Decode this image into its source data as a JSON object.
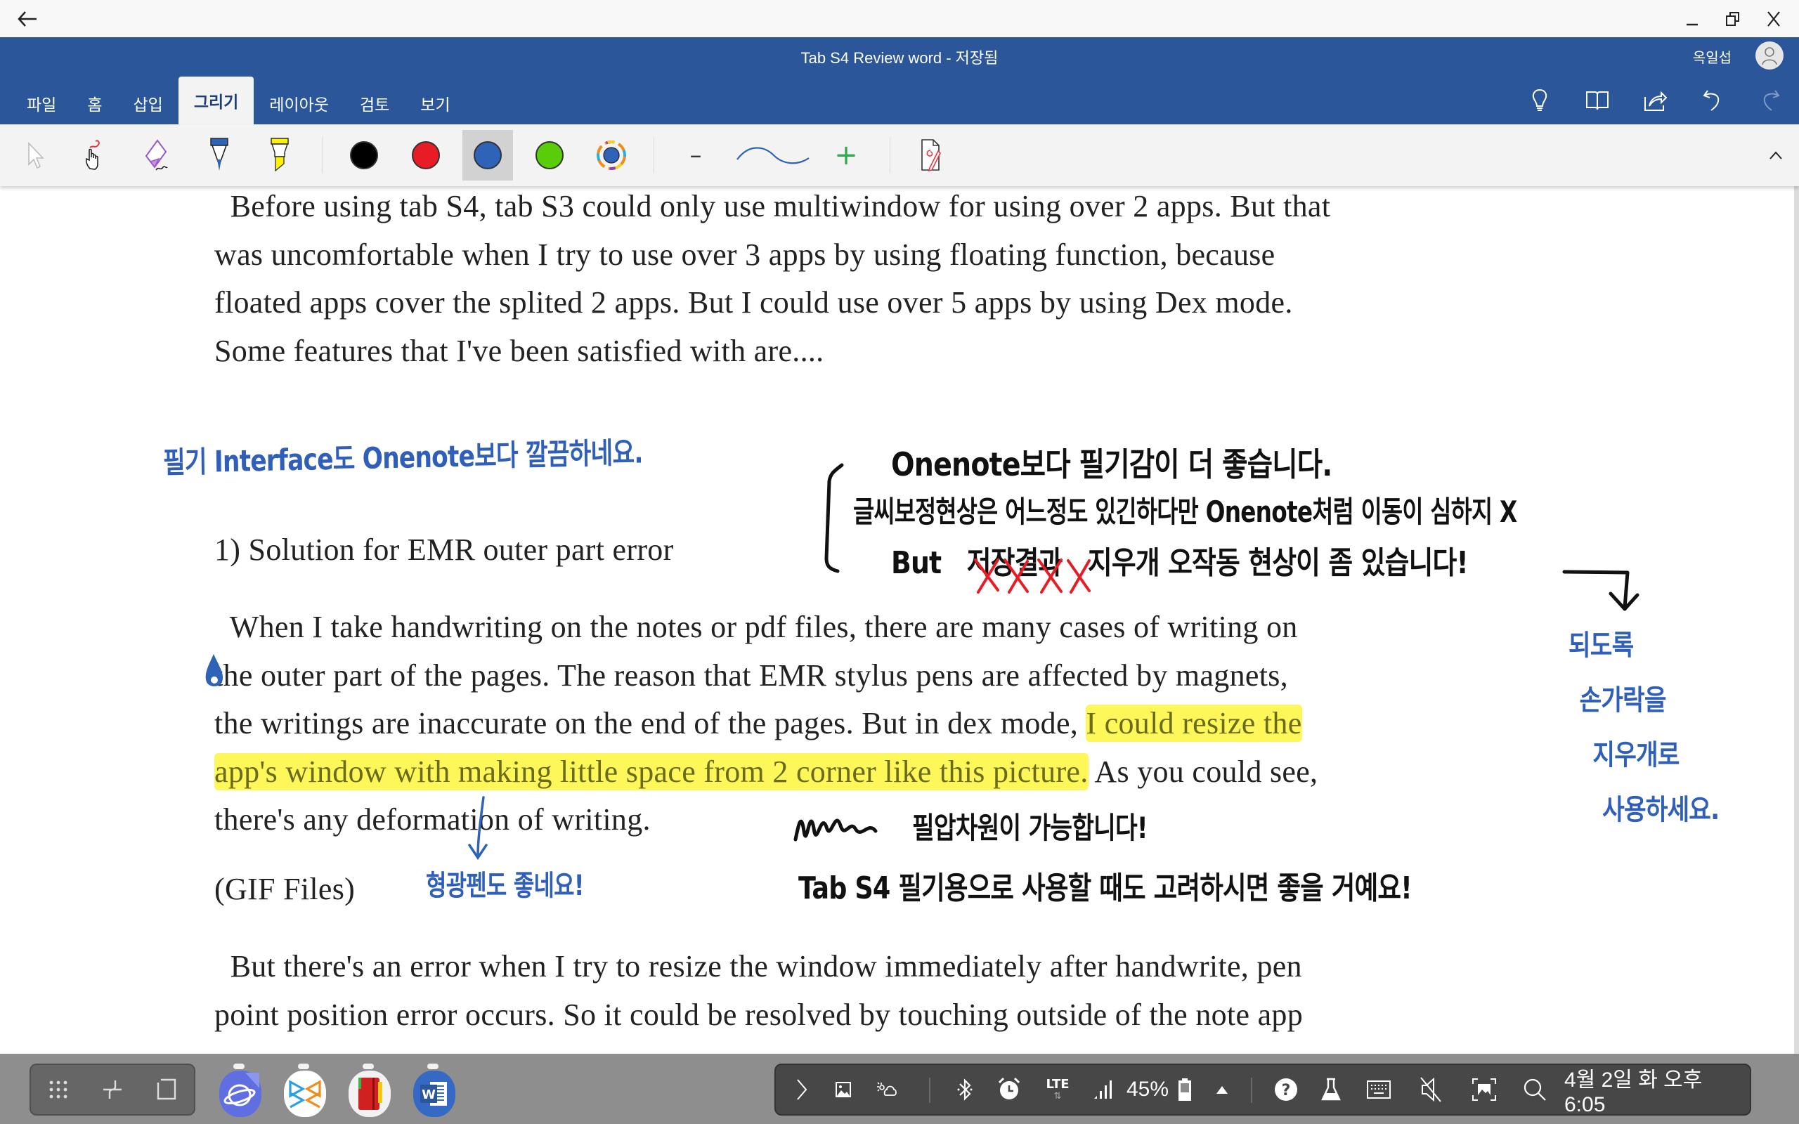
{
  "system_bar": {
    "back_icon": "arrow-left-icon",
    "window_controls": [
      {
        "name": "minimize",
        "icon": "minimize-icon",
        "glyph": "_"
      },
      {
        "name": "restore",
        "icon": "restore-window-icon",
        "glyph": "⧉"
      },
      {
        "name": "close",
        "icon": "close-icon",
        "glyph": "X"
      }
    ]
  },
  "title_bar": {
    "title": "Tab S4 Review word - 저장됨",
    "user_name": "옥일섭",
    "avatar_icon": "person-icon"
  },
  "ribbon": {
    "tabs": [
      {
        "label": "파일",
        "active": false
      },
      {
        "label": "홈",
        "active": false
      },
      {
        "label": "삽입",
        "active": false
      },
      {
        "label": "그리기",
        "active": true
      },
      {
        "label": "레이아웃",
        "active": false
      },
      {
        "label": "검토",
        "active": false
      },
      {
        "label": "보기",
        "active": false
      }
    ],
    "right_icons": [
      "lightbulb-icon",
      "book-reading-icon",
      "share-icon",
      "undo-icon",
      "redo-icon"
    ],
    "brand_color": "#2b579a"
  },
  "draw_toolbar": {
    "tools": [
      {
        "name": "select-objects",
        "icon": "pointer-arrow-icon"
      },
      {
        "name": "touch-draw",
        "icon": "hand-draw-icon"
      },
      {
        "name": "eraser",
        "icon": "eraser-icon"
      },
      {
        "name": "pen",
        "icon": "pen-icon"
      },
      {
        "name": "highlighter",
        "icon": "highlighter-icon"
      }
    ],
    "colors": [
      {
        "name": "black",
        "hex": "#000000",
        "selected": false
      },
      {
        "name": "red",
        "hex": "#e81c24",
        "selected": false
      },
      {
        "name": "blue",
        "hex": "#2e63b8",
        "selected": true
      },
      {
        "name": "green",
        "hex": "#5acd0a",
        "selected": false
      },
      {
        "name": "more-colors",
        "hex": "#2e63b8",
        "selected": false
      }
    ],
    "thickness": {
      "decrease_glyph": "–",
      "increase_glyph": "+"
    },
    "ink_to_shape_icon": "ink-editor-icon",
    "collapse_glyph": "^"
  },
  "document": {
    "paragraphs": [
      {
        "lines": [
          "  Before using tab S4, tab S3 could only use multiwindow for using over 2 apps. But that",
          "was uncomfortable when I try to use over 3 apps by using floating function, because",
          "floated apps cover the splited 2 apps. But I could use over 5 apps by using Dex mode.",
          "Some features that I've been satisfied with are...."
        ]
      },
      {
        "heading": "1) Solution for EMR outer part error"
      },
      {
        "lines": [
          "  When I take handwriting on the notes or pdf files, there are many cases of writing on",
          "the outer part of the pages. The reason that EMR stylus pens are affected by magnets,"
        ],
        "line3_plain": "the writings are inaccurate on the end of the pages. But in dex mode, ",
        "line3_highlight": "I could resize the",
        "line4_highlight": "app's window with making little space from 2 corner like this picture.",
        "line4_plain": " As you could see,",
        "line5": "there's any deformation of writing."
      },
      {
        "label": "(GIF Files)"
      },
      {
        "lines": [
          "  But there's an error when I try to resize the window immediately after handwrite, pen",
          "point position error occurs. So it could be resolved by touching outside of the note app"
        ]
      }
    ],
    "highlight_color": "#fdf75a",
    "ink_annotations": {
      "blue_1": "필기 Interface도  Onenote보다 깔끔하네요.",
      "black_1": "Onenote보다 필기감이 더 좋습니다.",
      "black_2": "글씨보정현상은 어느정도 있긴하다만  Onenote처럼 이동이 심하지 X",
      "black_3_prefix": "But",
      "black_3_struck": "저장결과",
      "black_3_rest": "지우개 오작동 현상이 좀 있습니다!",
      "blue_side": [
        "되도록",
        "손가락을",
        "지우개로",
        "사용하세요."
      ],
      "black_4": "필압차원이 가능합니다!",
      "blue_2": "형광펜도 좋네요!",
      "black_5": "Tab S4 필기용으로 사용할 때도 고려하시면 좋을 거예요!"
    },
    "ink_colors": {
      "blue": "#2f5fb8",
      "black": "#111111",
      "red": "#e81c24"
    }
  },
  "taskbar": {
    "nav_buttons": [
      {
        "name": "apps",
        "icon": "apps-grid-icon"
      },
      {
        "name": "recents",
        "icon": "recents-icon"
      },
      {
        "name": "home",
        "icon": "home-square-icon"
      }
    ],
    "apps": [
      {
        "name": "Samsung Internet Beta",
        "icon": "samsung-internet-beta-icon",
        "badge": "BETA"
      },
      {
        "name": "Polaris Office",
        "icon": "polaris-office-icon"
      },
      {
        "name": "Notes",
        "icon": "red-notebook-icon"
      },
      {
        "name": "Word",
        "icon": "word-icon",
        "letter": "W"
      }
    ],
    "tray": {
      "expand_icon": "chevron-right-icon",
      "icons_left": [
        "gallery-icon",
        "weather-icon"
      ],
      "icons_status": [
        "bluetooth-icon",
        "alarm-icon"
      ],
      "network_label": "LTE",
      "signal_icon": "signal-icon",
      "battery_percent": "45%",
      "battery_icon": "battery-icon",
      "notifications_icon": "triangle-up-icon",
      "icons_right": [
        "help-icon",
        "lab-flask-icon",
        "keyboard-icon",
        "mute-icon",
        "screenshot-icon",
        "search-icon"
      ],
      "datetime": "4월 2일 화 오후 6:05"
    }
  }
}
